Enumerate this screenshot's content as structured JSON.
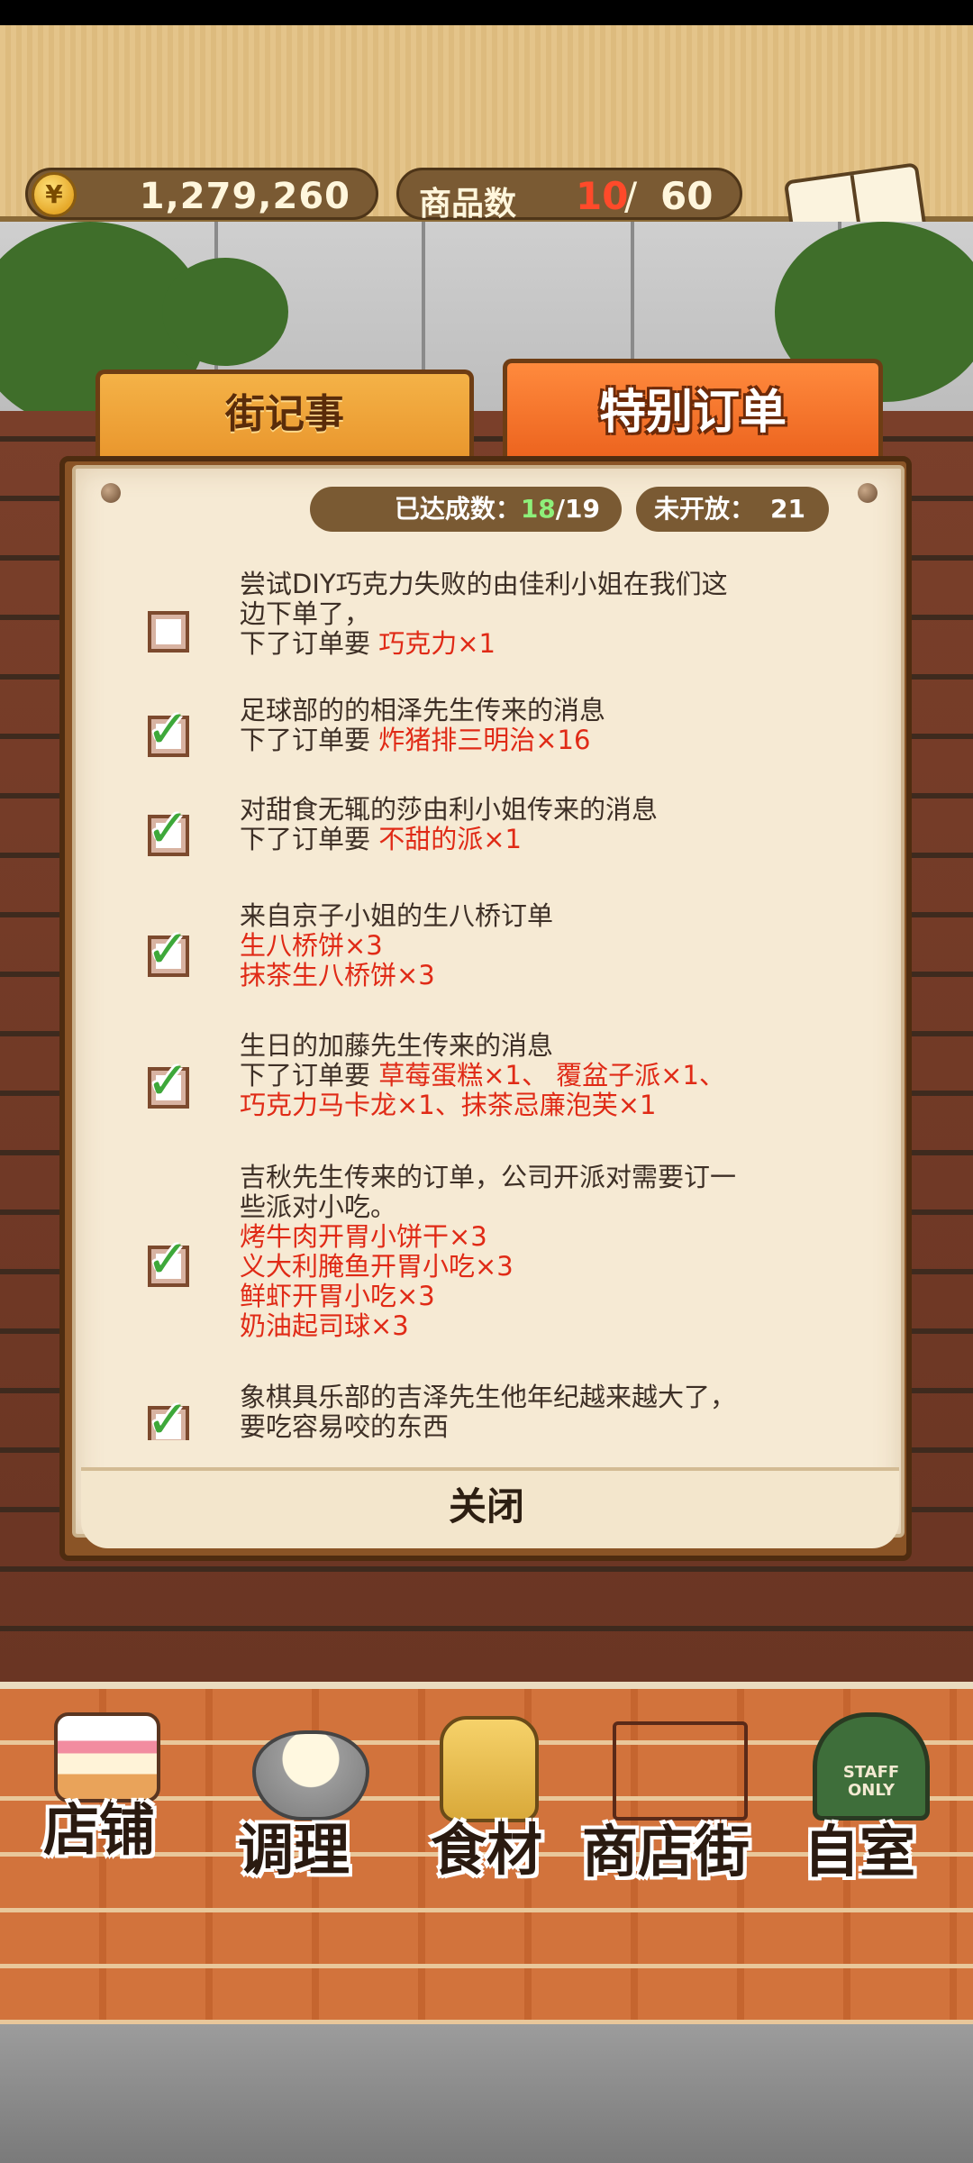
{
  "header": {
    "coin_symbol": "¥",
    "coins": "1,279,260",
    "items_label": "商品数",
    "items_current": "10",
    "items_separator": "/",
    "items_max": "60",
    "recipe_label": "食谱"
  },
  "tabs": [
    {
      "label": "街记事",
      "active": false
    },
    {
      "label": "特别订单",
      "active": true
    }
  ],
  "stats": {
    "achieved_label": "已达成数：",
    "achieved_current": "18",
    "achieved_separator": "/",
    "achieved_total": "19",
    "unopened_label": "未开放：",
    "unopened_count": "21"
  },
  "orders": [
    {
      "done": false,
      "line1": "尝试DIY巧克力失败的由佳利小姐在我们这",
      "line2": "边下单了，",
      "line3_prefix": "下了订单要 ",
      "line3_red": "巧克力×1"
    },
    {
      "done": true,
      "line1": "足球部的的相泽先生传来的消息",
      "line2_prefix": "下了订单要 ",
      "line2_red": "炸猪排三明治×16"
    },
    {
      "done": true,
      "line1": "对甜食无辄的莎由利小姐传来的消息",
      "line2_prefix": "下了订单要 ",
      "line2_red": "不甜的派×1"
    },
    {
      "done": true,
      "line1": "来自京子小姐的生八桥订单",
      "red1": "生八桥饼×3",
      "red2": "抹茶生八桥饼×3"
    },
    {
      "done": true,
      "line1": "生日的加藤先生传来的消息",
      "line2_prefix": "下了订单要 ",
      "line2_red": "草莓蛋糕×1、 覆盆子派×1、",
      "line3_red": "巧克力马卡龙×1、抹茶忌廉泡芙×1"
    },
    {
      "done": true,
      "line1": "吉秋先生传来的订单，公司开派对需要订一",
      "line2": "些派对小吃。",
      "red1": "烤牛肉开胃小饼干×3",
      "red2": "义大利腌鱼开胃小吃×3",
      "red3": "鲜虾开胃小吃×3",
      "red4": "奶油起司球×3"
    },
    {
      "done": true,
      "line1": "象棋具乐部的吉泽先生他年纪越来越大了，",
      "line2": "要吃容易咬的东西"
    }
  ],
  "close_label": "关闭",
  "nav": [
    {
      "label": "店铺",
      "icon": "cake-icon"
    },
    {
      "label": "调理",
      "icon": "mixing-bowl-icon"
    },
    {
      "label": "食材",
      "icon": "flour-sack-icon"
    },
    {
      "label": "商店街",
      "icon": "shop-icon"
    },
    {
      "label": "自室",
      "icon": "staff-only-door-icon"
    }
  ],
  "door_sign": "STAFF ONLY",
  "check_glyph": "✓",
  "colors": {
    "accent_orange": "#ea5f1b",
    "highlight_red": "#e02a16",
    "achieved_green": "#8ef07a"
  }
}
